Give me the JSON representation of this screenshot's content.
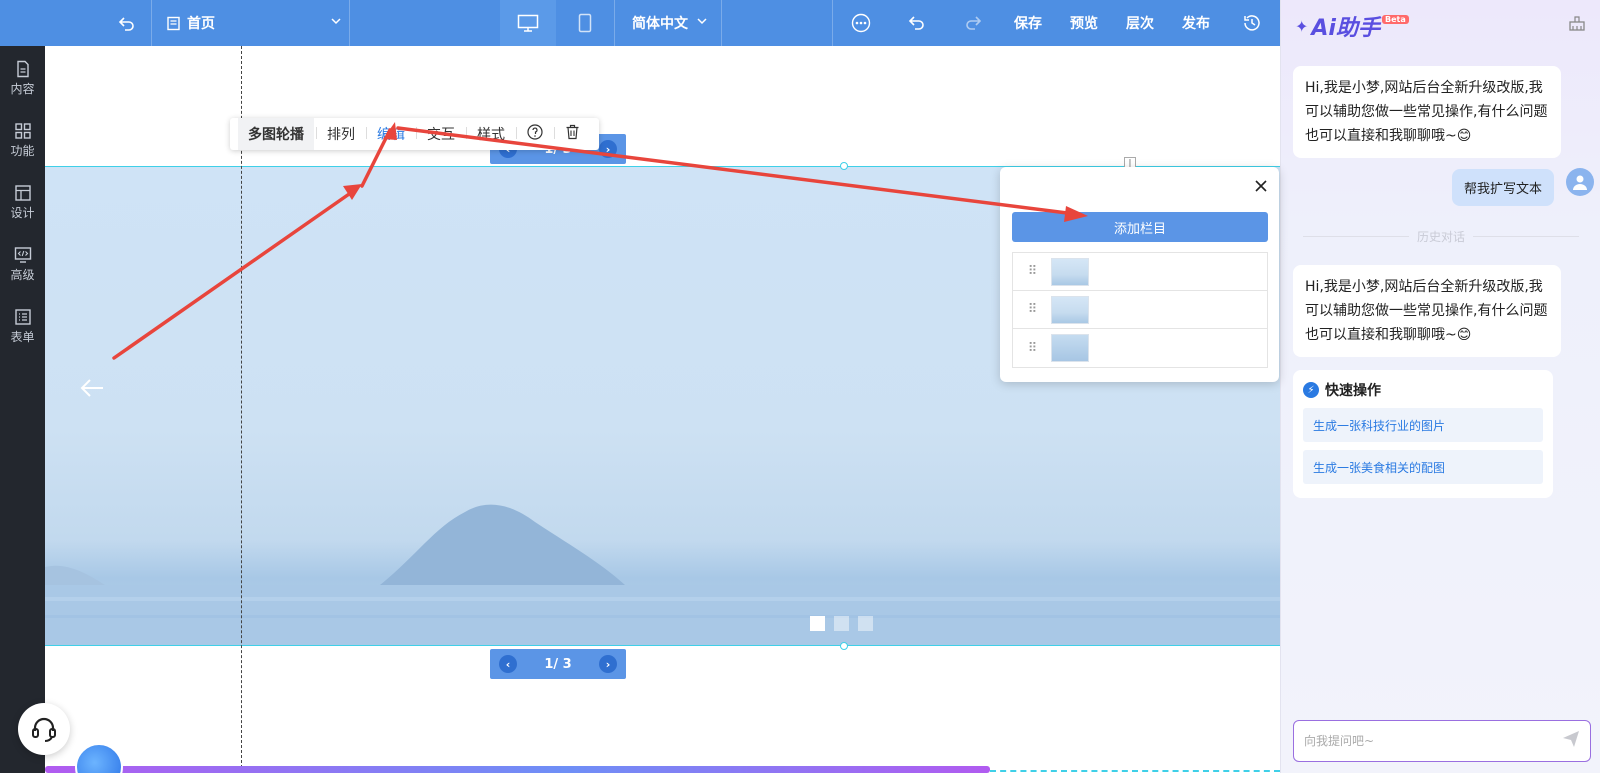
{
  "toolbar": {
    "page_label": "首页",
    "language_label": "简体中文",
    "save_label": "保存",
    "preview_label": "预览",
    "layers_label": "层次",
    "publish_label": "发布"
  },
  "leftnav": {
    "items": [
      {
        "label": "内容",
        "icon": "document-icon"
      },
      {
        "label": "功能",
        "icon": "grid-icon"
      },
      {
        "label": "设计",
        "icon": "layout-icon"
      },
      {
        "label": "高级",
        "icon": "code-icon"
      },
      {
        "label": "表单",
        "icon": "form-icon"
      }
    ]
  },
  "component_toolbar": {
    "items": [
      "多图轮播",
      "排列",
      "编辑",
      "交互",
      "样式"
    ],
    "active": "编辑"
  },
  "carousel": {
    "pager_text": "1/ 3",
    "current_slide": 1,
    "slide_count": 3
  },
  "edit_popup": {
    "add_button_label": "添加栏目",
    "close_icon": "close-icon",
    "rows": 3
  },
  "ai_panel": {
    "logo_text": "Ai助手",
    "beta_badge": "Beta",
    "greeting": "Hi,我是小梦,网站后台全新升级改版,我可以辅助您做一些常见操作,有什么问题也可以直接和我聊聊哦~😊",
    "user_message": "帮我扩写文本",
    "history_label": "历史对话",
    "greeting_repeat": "Hi,我是小梦,网站后台全新升级改版,我可以辅助您做一些常见操作,有什么问题也可以直接和我聊聊哦~😊",
    "quick_title": "快速操作",
    "quick_items": [
      "生成一张科技行业的图片",
      "生成一张美食相关的配图"
    ],
    "input_placeholder": "向我提问吧~"
  },
  "colors": {
    "toolbar_bg": "#4e8fe3",
    "leftnav_bg": "#23272e",
    "accent": "#2a7ae2",
    "annotation_arrow": "#e8453c"
  }
}
